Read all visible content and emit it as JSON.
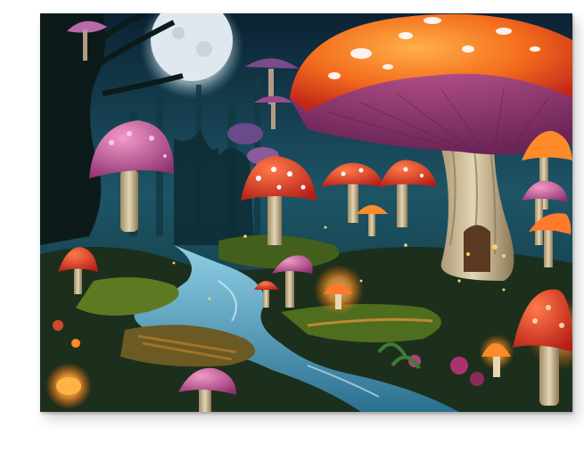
{
  "scene": {
    "subject": "fantasy-mushroom-forest-canvas",
    "colors": {
      "sky_top": "#0c2a3c",
      "sky_mid": "#1f5a6e",
      "moon": "#dfe6ea",
      "forest_dark": "#0a1a1f",
      "mushroom_orange": "#f07a1c",
      "mushroom_red": "#e23a22",
      "mushroom_pink": "#c04a8c",
      "gills": "#9c3a78",
      "stem": "#d9c9a3",
      "river": "#5fa8c8",
      "moss": "#5d7a22",
      "path": "#b07a2a",
      "glow": "#ffb347"
    }
  }
}
